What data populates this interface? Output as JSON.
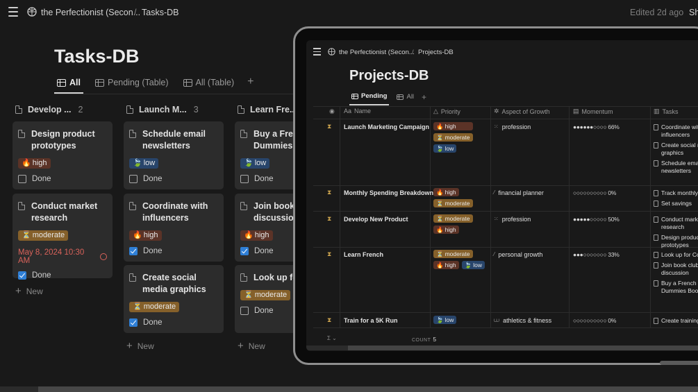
{
  "topbar": {
    "workspace": "the Perfectionist (Secon...",
    "separator": "/",
    "page": "Tasks-DB",
    "edited": "Edited 2d ago",
    "share": "Sh"
  },
  "page_title": "Tasks-DB",
  "views": [
    {
      "label": "All"
    },
    {
      "label": "Pending (Table)"
    },
    {
      "label": "All (Table)"
    }
  ],
  "add_view": "+",
  "columns": [
    {
      "title": "Develop ...",
      "count": "2"
    },
    {
      "title": "Launch M...",
      "count": "3"
    },
    {
      "title": "Learn Fre...",
      "count": ""
    }
  ],
  "cards": {
    "c1": {
      "title": "Design product prototypes",
      "tag": "high",
      "done": "Done"
    },
    "c2": {
      "title": "Conduct market research",
      "tag": "moderate",
      "date": "May 8, 2024 10:30 AM",
      "done": "Done"
    },
    "c3": {
      "title": "Schedule email newsletters",
      "tag": "low",
      "done": "Done"
    },
    "c4": {
      "title": "Coordinate with influencers",
      "tag": "high",
      "done": "Done"
    },
    "c5": {
      "title": "Create social media graphics",
      "tag": "moderate",
      "done": "Done"
    },
    "c6": {
      "title": "Buy a French for Dummies Book",
      "tag": "low",
      "done": "Done"
    },
    "c7": {
      "title": "Join book club discussion",
      "tag": "high",
      "done": "Done"
    },
    "c8": {
      "title": "Look up for Content",
      "tag": "moderate",
      "done": "Done"
    }
  },
  "new_label": "New",
  "icons": {
    "high": "🔥",
    "moderate": "⏳",
    "low": "🍃"
  },
  "laptop": {
    "workspace": "the Perfectionist (Secon...",
    "separator": "/",
    "page": "Projects-DB",
    "title": "Projects-DB",
    "views": [
      {
        "label": "Pending"
      },
      {
        "label": "All"
      }
    ],
    "add": "+",
    "headers": {
      "name": "Name",
      "priority": "Priority",
      "aspect": "Aspect of Growth",
      "momentum": "Momentum",
      "tasks": "Tasks"
    },
    "rows": [
      {
        "name": "Launch Marketing Campaign",
        "tags": [
          "high",
          "moderate",
          "low"
        ],
        "aspect": "profession",
        "momentum": "●●●●●●○○○○ 66%",
        "tasks": [
          "Coordinate with influencers",
          "Create social media graphics",
          "Schedule email newsletters"
        ]
      },
      {
        "name": "Monthly Spending Breakdown",
        "tags": [
          "high",
          "moderate"
        ],
        "aspect": "financial planner",
        "momentum": "○○○○○○○○○○ 0%",
        "tasks": [
          "Track monthly",
          "Set savings"
        ]
      },
      {
        "name": "Develop New Product",
        "tags": [
          "moderate",
          "high"
        ],
        "aspect": "profession",
        "momentum": "●●●●●○○○○○ 50%",
        "tasks": [
          "Conduct market research",
          "Design product prototypes"
        ]
      },
      {
        "name": "Learn French",
        "tags": [
          "moderate",
          "high",
          "low"
        ],
        "aspect": "personal growth",
        "momentum": "●●●○○○○○○○ 33%",
        "tasks": [
          "Look up for Content",
          "Join book club discussion",
          "Buy a French for Dummies Book"
        ]
      },
      {
        "name": "Train for a 5K Run",
        "tags": [
          "low"
        ],
        "aspect": "athletics & fitness",
        "momentum": "○○○○○○○○○○ 0%",
        "tasks": [
          "Create training"
        ]
      }
    ],
    "footer": {
      "sigma": "Σ ⌄",
      "count_label": "COUNT",
      "count_value": "5"
    }
  },
  "colors": {
    "background": "#191919",
    "card": "#2c2c2c",
    "high_tag": "#5b3327",
    "moderate_tag": "#85602a",
    "low_tag": "#28456b",
    "checkbox_on": "#2f7fd6",
    "date_red": "#d8625a"
  }
}
